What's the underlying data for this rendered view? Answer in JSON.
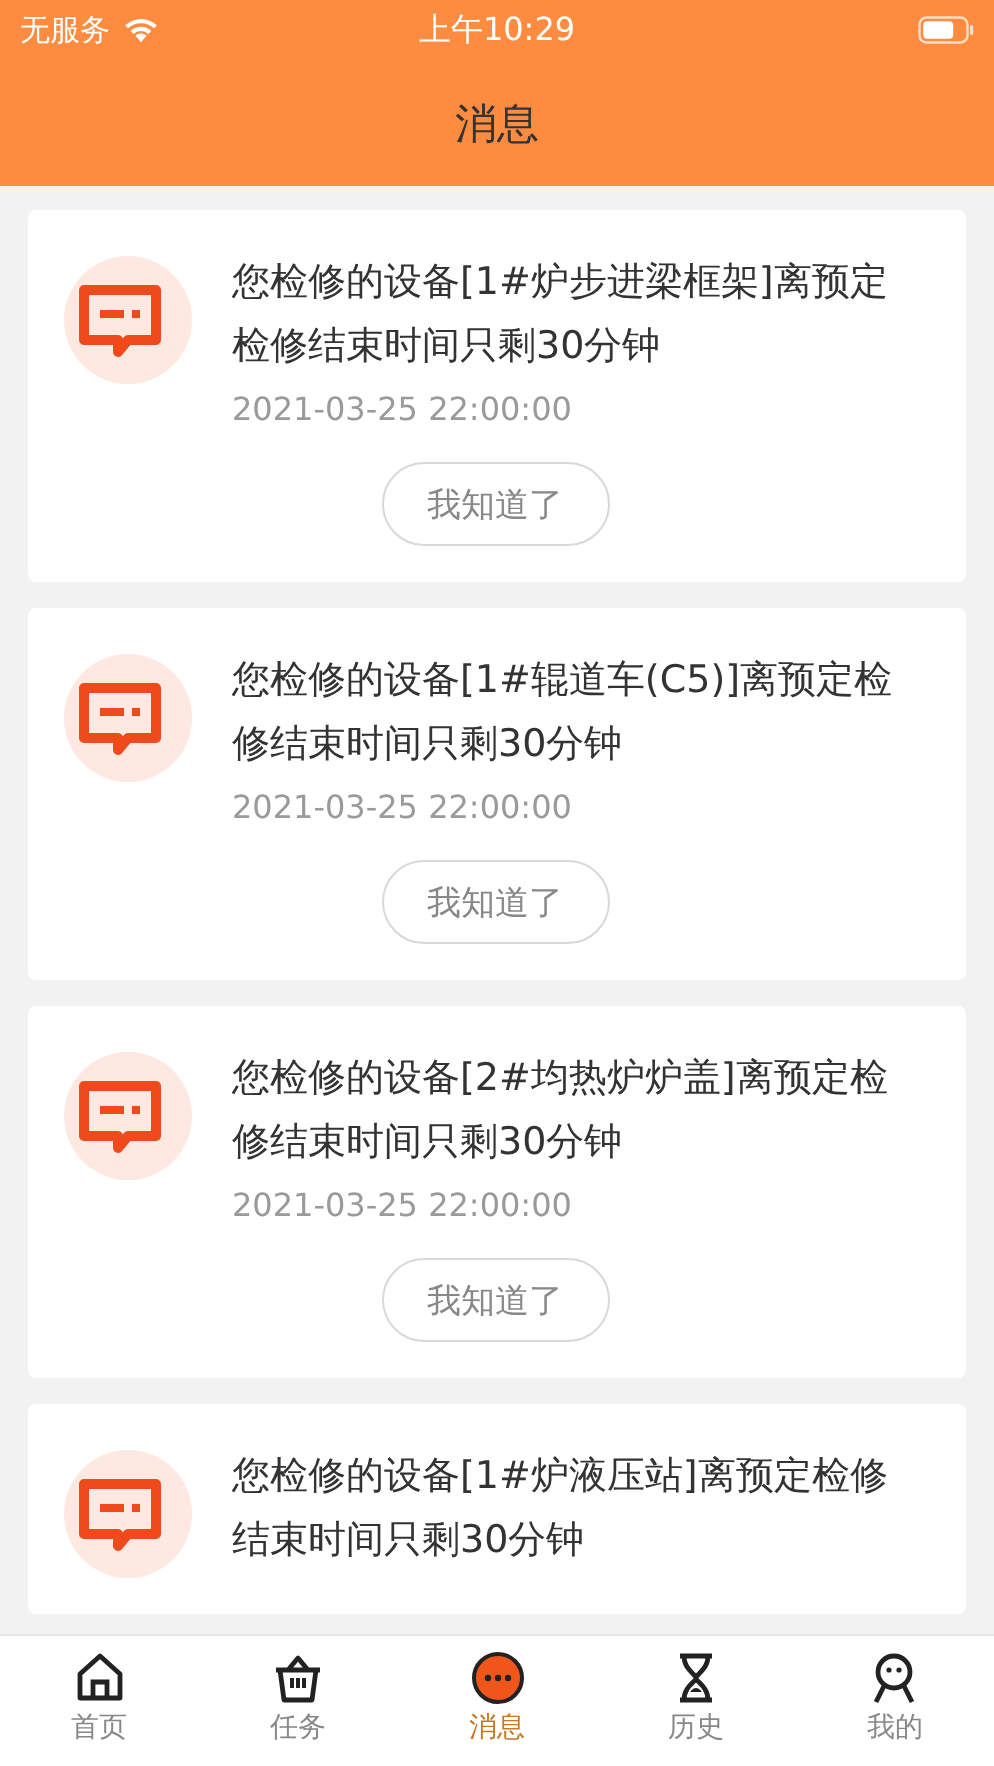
{
  "status_bar": {
    "carrier": "无服务",
    "time": "上午10:29"
  },
  "header": {
    "title": "消息"
  },
  "messages": [
    {
      "text": "您检修的设备[1#炉步进梁框架]离预定检修结束时间只剩30分钟",
      "time": "2021-03-25 22:00:00",
      "button": "我知道了"
    },
    {
      "text": "您检修的设备[1#辊道车(C5)]离预定检修结束时间只剩30分钟",
      "time": "2021-03-25 22:00:00",
      "button": "我知道了"
    },
    {
      "text": "您检修的设备[2#均热炉炉盖]离预定检修结束时间只剩30分钟",
      "time": "2021-03-25 22:00:00",
      "button": "我知道了"
    },
    {
      "text": "您检修的设备[1#炉液压站]离预定检修结束时间只剩30分钟"
    }
  ],
  "tab_bar": [
    {
      "kind": "home",
      "label": "首页",
      "selected": false
    },
    {
      "kind": "task",
      "label": "任务",
      "selected": false
    },
    {
      "kind": "message",
      "label": "消息",
      "selected": true
    },
    {
      "kind": "history",
      "label": "历史",
      "selected": false
    },
    {
      "kind": "profile",
      "label": "我的",
      "selected": false
    }
  ]
}
